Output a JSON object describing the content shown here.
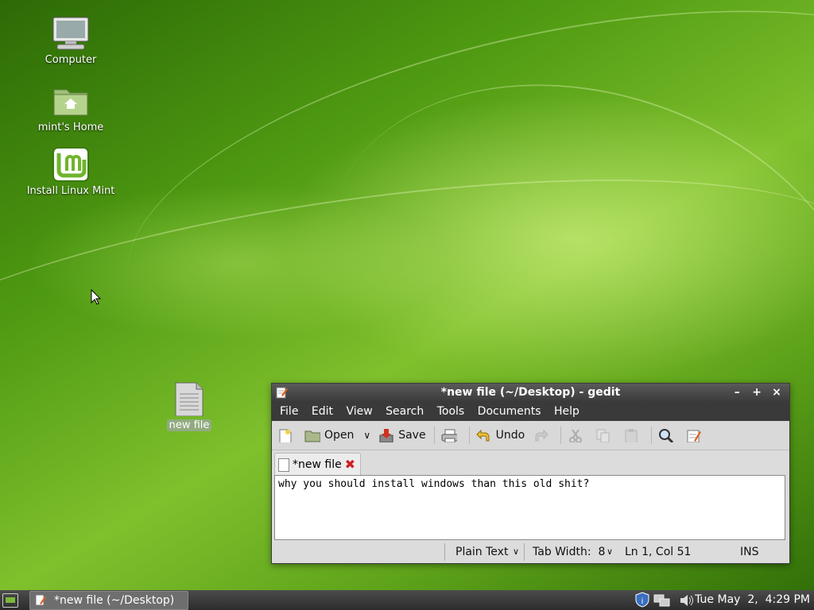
{
  "desktop": {
    "icons": [
      {
        "label": "Computer"
      },
      {
        "label": "mint's Home"
      },
      {
        "label": "Install Linux Mint"
      },
      {
        "label": "new file"
      }
    ]
  },
  "window": {
    "title": "*new file (~/Desktop) - gedit",
    "controls": {
      "minimize": "–",
      "maximize": "+",
      "close": "×"
    },
    "menu": [
      "File",
      "Edit",
      "View",
      "Search",
      "Tools",
      "Documents",
      "Help"
    ],
    "toolbar": {
      "open": "Open",
      "save": "Save",
      "undo": "Undo"
    },
    "tab": {
      "label": "*new file",
      "close": "✖"
    },
    "editor_text": "why you should install windows than this old shit?",
    "status": {
      "language": "Plain Text",
      "tab_width": "Tab Width:  8",
      "position": "Ln 1, Col 51",
      "mode": "INS"
    }
  },
  "panel": {
    "task_label": "*new file (~/Desktop) ...",
    "clock": "Tue May  2,  4:29 PM"
  },
  "colors": {
    "accent": "#7fc02d",
    "panel": "#3a3a3a"
  }
}
